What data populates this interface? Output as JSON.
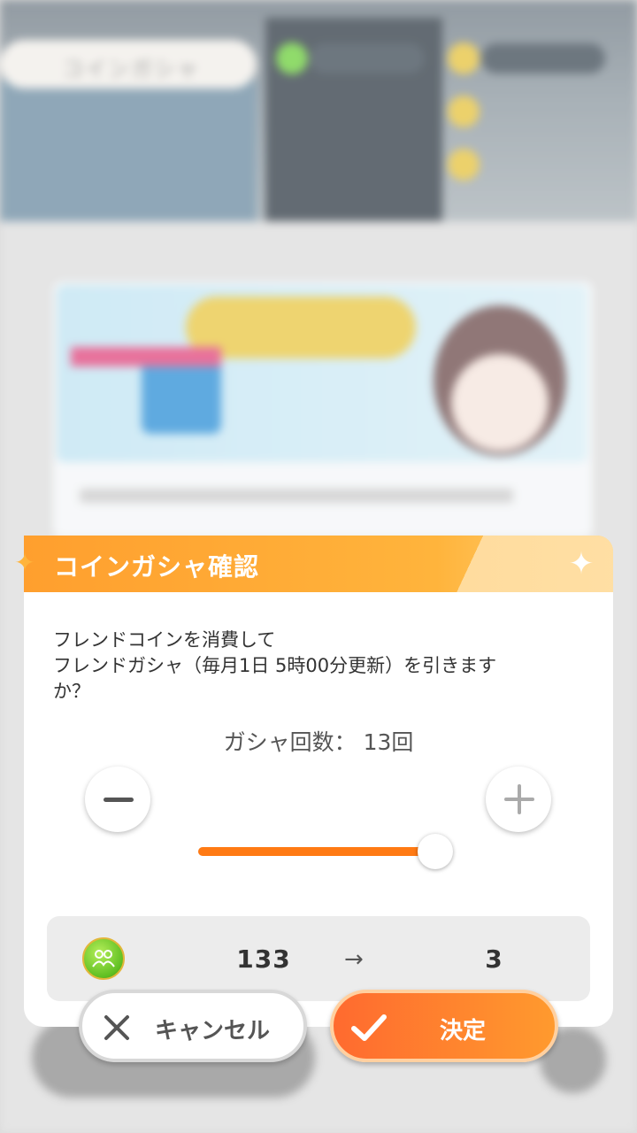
{
  "background": {
    "shop_label": "コインガシャ",
    "card_title": "フレンドガシャ（毎月1日 5時00分更新）"
  },
  "dialog": {
    "title": "コインガシャ確認",
    "message_line1": "フレンドコインを消費して",
    "message_line2": "フレンドガシャ（毎月1日 5時00分更新）を引きます",
    "message_line3": "か？",
    "count_label": "ガシャ回数：",
    "count_value": "13回",
    "slider_fraction": 1.0,
    "coin_icon": "friend-coin-icon",
    "coin_from": "133",
    "coin_arrow": "→",
    "coin_to": "3",
    "cancel_label": "キャンセル",
    "confirm_label": "決定"
  },
  "colors": {
    "accent": "#ff7a14",
    "header": "#ffa833",
    "confirm": "#ff6a2f"
  }
}
